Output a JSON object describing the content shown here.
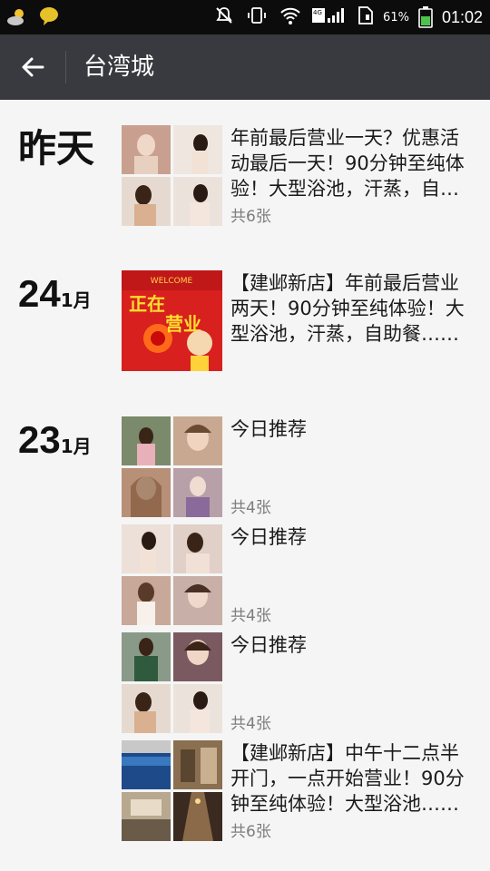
{
  "status_bar": {
    "battery_percent": "61%",
    "time": "01:02",
    "network": "4G",
    "icons": [
      "weather-icon",
      "chat-bubble-icon",
      "mute-icon",
      "vibrate-icon",
      "wifi-icon",
      "signal-icon",
      "sim-icon",
      "battery-icon"
    ]
  },
  "app_bar": {
    "back_icon": "arrow-left-icon",
    "title": "台湾城"
  },
  "groups": [
    {
      "date_label": "昨天",
      "posts": [
        {
          "text": "年前最后营业一天？优惠活动最后一天！90分钟至纯体验！大型浴池，汗蒸，自助餐……",
          "count": "共6张",
          "thumb_colors": [
            "#c9a090",
            "#e8dcd4",
            "#d9b9a0",
            "#e4d6ce"
          ]
        }
      ]
    },
    {
      "day": "24",
      "month": "1月",
      "posts": [
        {
          "text": "【建邺新店】年前最后营业两天！90分钟至纯体验！大型浴池，汗蒸，自助餐……",
          "count": "",
          "image_words": [
            "WELCOME",
            "正在",
            "营业"
          ]
        }
      ]
    },
    {
      "day": "23",
      "month": "1月",
      "posts": [
        {
          "text": "今日推荐",
          "count": "共4张",
          "thumb_colors": [
            "#7a8a6a",
            "#c8a890",
            "#b89078",
            "#b8a0a8"
          ]
        },
        {
          "text": "今日推荐",
          "count": "共4张",
          "thumb_colors": [
            "#d8c8bc",
            "#e0d0c8",
            "#e8d8d0",
            "#c8b0a8"
          ]
        },
        {
          "text": "今日推荐",
          "count": "共4张",
          "thumb_colors": [
            "#3f5a4a",
            "#7a5a60",
            "#d8c8bc",
            "#e4d6ce"
          ]
        },
        {
          "text": "【建邺新店】中午十二点半开门，一点开始营业！90分钟至纯体验！大型浴池……",
          "count": "共6张",
          "thumb_colors": [
            "#2a4a7a",
            "#8a7050",
            "#b8a890",
            "#3a2a20"
          ]
        }
      ]
    }
  ]
}
